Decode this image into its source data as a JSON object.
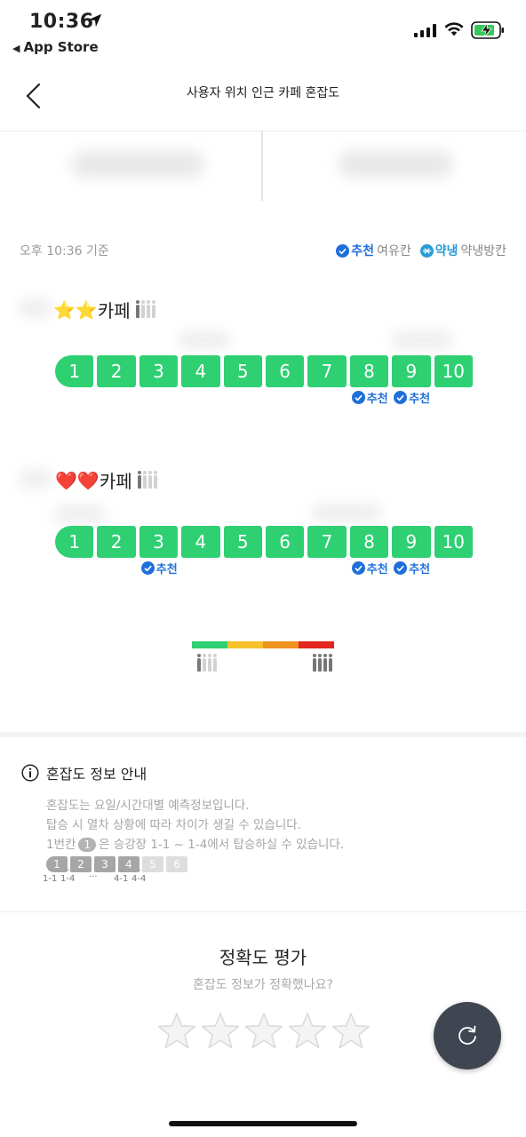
{
  "status_bar": {
    "time": "10:36",
    "back_app": "App Store"
  },
  "nav": {
    "title": "사용자 위치 인근 카페 혼잡도"
  },
  "legend": {
    "time_label": "오후 10:36 기준",
    "recommend": "추천",
    "spare_car": "여유칸",
    "cool": "약냉",
    "cool_car": "약냉방칸"
  },
  "cafes": [
    {
      "emoji": "⭐⭐",
      "name": "카페",
      "crowd_level": 1,
      "cars": [
        "1",
        "2",
        "3",
        "4",
        "5",
        "6",
        "7",
        "8",
        "9",
        "10"
      ],
      "recommended_cars": [
        8,
        9
      ],
      "tag": "추천"
    },
    {
      "emoji": "❤️❤️",
      "name": "카페",
      "crowd_level": 1,
      "cars": [
        "1",
        "2",
        "3",
        "4",
        "5",
        "6",
        "7",
        "8",
        "9",
        "10"
      ],
      "recommended_cars": [
        3,
        8,
        9
      ],
      "tag": "추천"
    }
  ],
  "scale": {
    "colors": [
      "#2ed072",
      "#f5c02a",
      "#f0921e",
      "#e2261e"
    ]
  },
  "info": {
    "title": "혼잡도 정보 안내",
    "line1": "혼잡도는 요일/시간대별 예측정보입니다.",
    "line2": "탑승 시 열차 상황에 따라 차이가 생길 수 있습니다.",
    "line3_prefix": "1번칸",
    "line3_chip": "1",
    "line3_suffix": "은 승강장 1-1 ~ 1-4에서 탑승하실 수 있습니다.",
    "mini_cars": [
      "1",
      "2",
      "3",
      "4",
      "5",
      "6"
    ],
    "mini_labels": [
      "1-1",
      "1-4",
      "···",
      "4-1",
      "4-4"
    ]
  },
  "rating": {
    "title": "정확도 평가",
    "subtitle": "혼잡도 정보가 정확했나요?",
    "stars": 5
  },
  "colors": {
    "green": "#2ed072",
    "recommend_blue": "#1e6fd9",
    "fab": "#3f4651"
  }
}
